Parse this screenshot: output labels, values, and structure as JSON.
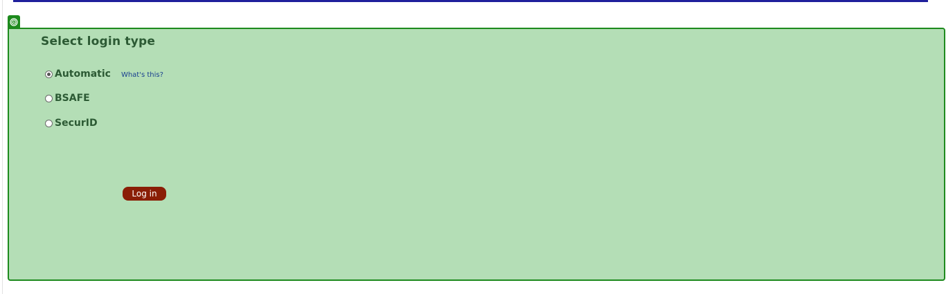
{
  "panel": {
    "title": "Select login type",
    "corner_icon": "target-icon",
    "options": [
      {
        "label": "Automatic",
        "selected": true
      },
      {
        "label": "BSAFE",
        "selected": false
      },
      {
        "label": "SecurID",
        "selected": false
      }
    ],
    "help_link": "What's this?",
    "login_button": "Log in"
  },
  "colors": {
    "top_rule": "#1f1f9c",
    "panel_background": "#b4deb6",
    "panel_border": "#1d8a1d",
    "text": "#2c5a34",
    "link": "#1a3f8f",
    "button": "#8a1e06"
  }
}
